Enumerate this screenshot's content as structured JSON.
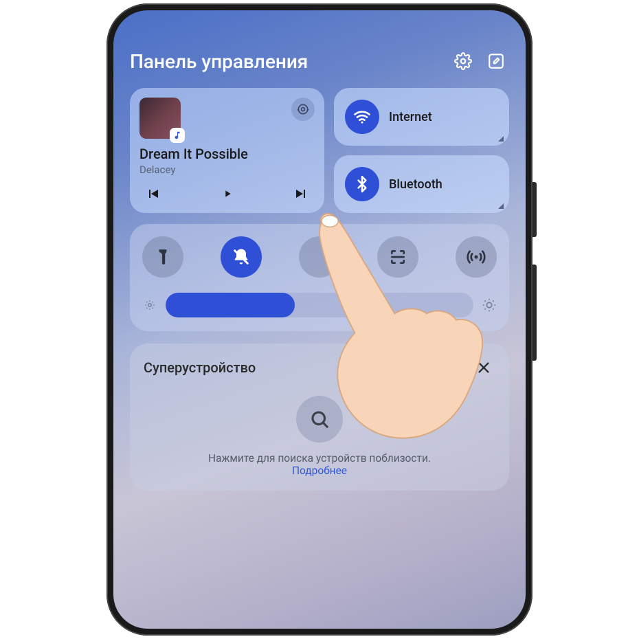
{
  "header": {
    "title": "Панель управления"
  },
  "media": {
    "track": "Dream It Possible",
    "artist": "Delacey"
  },
  "conn": {
    "internet": "Internet",
    "bluetooth": "Bluetooth"
  },
  "super": {
    "title": "Суперустройство",
    "hint": "Нажмите для поиска устройств поблизости.",
    "more": "Подробнее"
  },
  "colors": {
    "accent": "#2e4fd6"
  }
}
